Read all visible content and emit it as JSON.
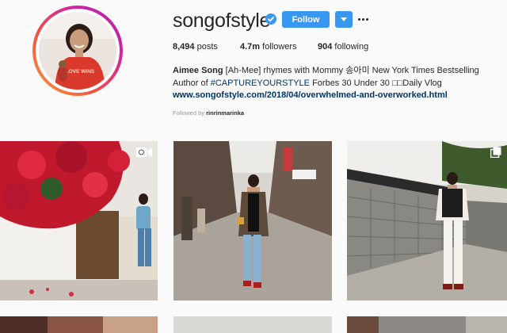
{
  "profile": {
    "username": "songofstyle",
    "verified": true,
    "follow_label": "Follow",
    "stats": {
      "posts_count": "8,494",
      "posts_label": "posts",
      "followers_count": "4.7m",
      "followers_label": "followers",
      "following_count": "904",
      "following_label": "following"
    },
    "bio": {
      "name": "Aimee Song",
      "text_1": "[Ah-Mee] rhymes with Mommy 송아미 New York Times Bestselling Author of ",
      "hashtag": "#CAPTUREYOURSTYLE",
      "text_2": " Forbes 30 Under 30 □□Daily Vlog"
    },
    "link": "www.songofstyle.com/2018/04/overwhelmed-and-overworked.html",
    "followed_by_label": "Followed by",
    "followed_by_user": "rinrinmarinka",
    "avatar_shirt_text": "LOVE WINS"
  },
  "posts": [
    {
      "type": "video",
      "icon": "video-camera-icon"
    },
    {
      "type": "photo",
      "icon": null
    },
    {
      "type": "multiple",
      "icon": "multiple-photos-icon"
    }
  ],
  "colors": {
    "accent": "#3897f0",
    "link": "#003569",
    "ring_start": "#f8a13a",
    "ring_end": "#b01fb3"
  }
}
